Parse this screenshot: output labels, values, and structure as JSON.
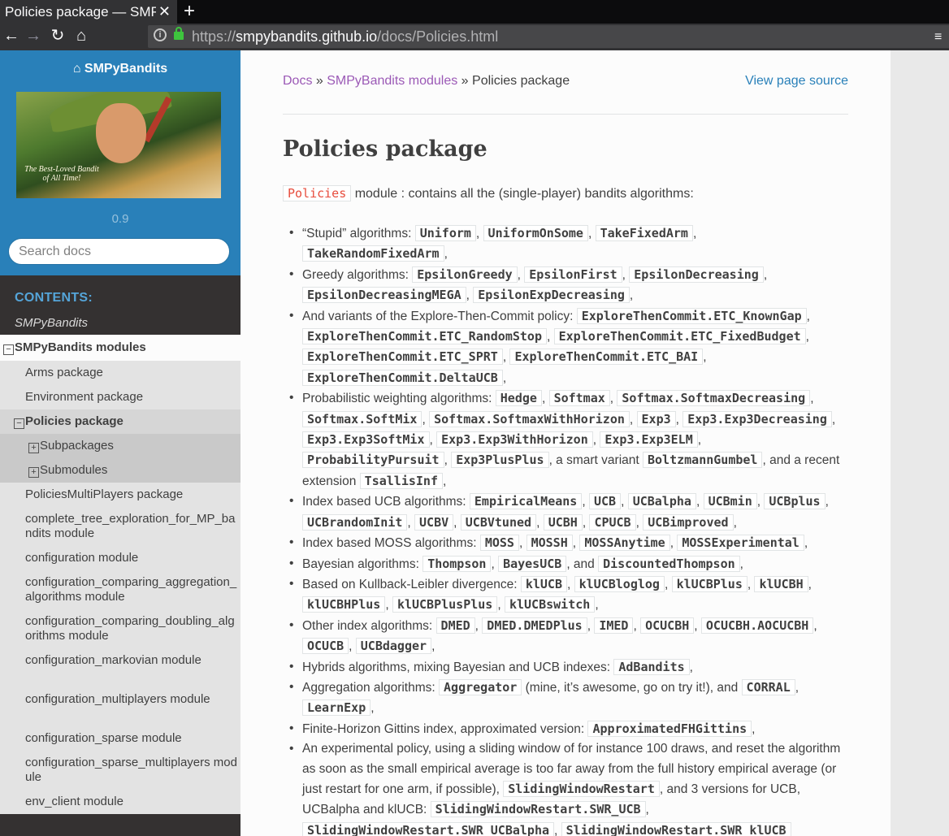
{
  "browser": {
    "tab_title": "Policies package — SMPyBandits",
    "tab_close": "✕",
    "new_tab": "+",
    "back": "←",
    "forward": "→",
    "reload": "↻",
    "home": "⌂",
    "url_scheme": "https://",
    "url_host": "smpybandits.github.io",
    "url_path": "/docs/Policies.html",
    "menu": "≡",
    "info_icon": "i"
  },
  "sidebar": {
    "project": "SMPyBandits",
    "project_icon": "home-icon",
    "logo_caption": "The Best-Loved Bandit of All Time!",
    "version": "0.9",
    "search_placeholder": "Search docs",
    "caption": "CONTENTS:",
    "root": "SMPyBandits",
    "current": "SMPyBandits modules",
    "items": [
      {
        "label": "Arms package"
      },
      {
        "label": "Environment package"
      },
      {
        "label": "Policies package"
      },
      {
        "label": "Subpackages"
      },
      {
        "label": "Submodules"
      },
      {
        "label": "PoliciesMultiPlayers package"
      },
      {
        "label": "complete_tree_exploration_for_MP_bandits module"
      },
      {
        "label": "configuration module"
      },
      {
        "label": "configuration_comparing_aggregation_algorithms module"
      },
      {
        "label": "configuration_comparing_doubling_algorithms module"
      },
      {
        "label": "configuration_markovian module"
      },
      {
        "label": "configuration_multiplayers module"
      },
      {
        "label": "configuration_sparse module"
      },
      {
        "label": "configuration_sparse_multiplayers module"
      },
      {
        "label": "env_client module"
      }
    ],
    "toggle_open": "⊟",
    "toggle_closed": "⊞"
  },
  "breadcrumbs": {
    "docs": "Docs",
    "sep1": " » ",
    "modules": "SMPyBandits modules",
    "sep2": " » ",
    "current": "Policies package"
  },
  "view_source": "View page source",
  "title": "Policies package",
  "intro": {
    "code": "Policies",
    "text": " module : contains all the (single-player) bandits algorithms:"
  }
}
